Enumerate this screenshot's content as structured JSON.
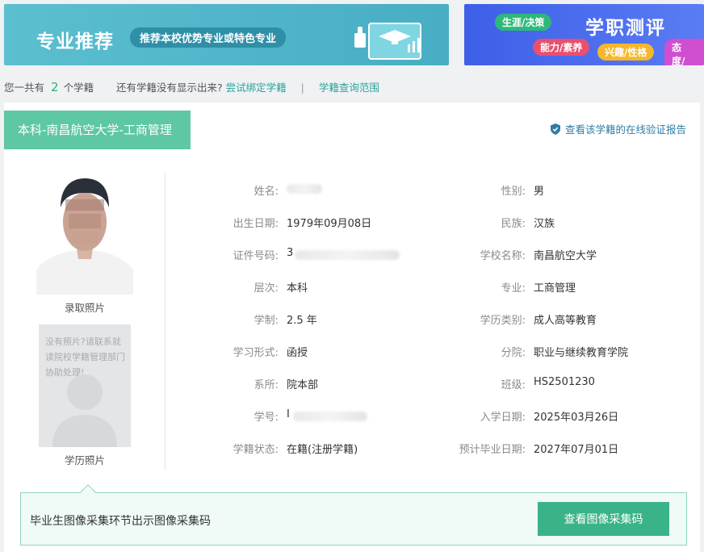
{
  "banners": {
    "left": {
      "title": "专业推荐",
      "pill": "推荐本校优势专业或特色专业"
    },
    "right": {
      "title": "学职测评",
      "tags": [
        "生涯/决策",
        "能力/素养",
        "兴趣/性格",
        "态度/评"
      ]
    }
  },
  "count_line": {
    "prefix": "您一共有",
    "count": "2",
    "suffix": "个学籍",
    "question": "还有学籍没有显示出来?",
    "bind_link": "尝试绑定学籍",
    "separator": "|",
    "scope_link": "学籍查询范围"
  },
  "card": {
    "degree_tab": "本科-南昌航空大学-工商管理",
    "verify_link": "查看该学籍的在线验证报告",
    "admission_photo_caption": "录取照片",
    "edu_photo_message": "没有照片?请联系就读院校学籍管理部门协助处理!",
    "edu_photo_caption": "学历照片",
    "left_fields": [
      {
        "label": "姓名:",
        "value": ""
      },
      {
        "label": "出生日期:",
        "value": "1979年09月08日"
      },
      {
        "label": "证件号码:",
        "value": "3"
      },
      {
        "label": "层次:",
        "value": "本科"
      },
      {
        "label": "学制:",
        "value": "2.5 年"
      },
      {
        "label": "学习形式:",
        "value": "函授"
      },
      {
        "label": "系所:",
        "value": "院本部"
      },
      {
        "label": "学号:",
        "value": "I"
      },
      {
        "label": "学籍状态:",
        "value": "在籍(注册学籍)"
      }
    ],
    "right_fields": [
      {
        "label": "性别:",
        "value": "男"
      },
      {
        "label": "民族:",
        "value": "汉族"
      },
      {
        "label": "学校名称:",
        "value": "南昌航空大学"
      },
      {
        "label": "专业:",
        "value": "工商管理"
      },
      {
        "label": "学历类别:",
        "value": "成人高等教育"
      },
      {
        "label": "分院:",
        "value": "职业与继续教育学院"
      },
      {
        "label": "班级:",
        "value": "HS2501230"
      },
      {
        "label": "入学日期:",
        "value": "2025年03月26日"
      },
      {
        "label": "预计毕业日期:",
        "value": "2027年07月01日"
      }
    ]
  },
  "bottom_bar": {
    "text": "毕业生图像采集环节出示图像采集码",
    "button": "查看图像采集码"
  },
  "colors": {
    "accent_green": "#5ec7a4",
    "button_green": "#3bb388",
    "link": "#2aa59a",
    "verify_blue": "#2f7ca6"
  }
}
